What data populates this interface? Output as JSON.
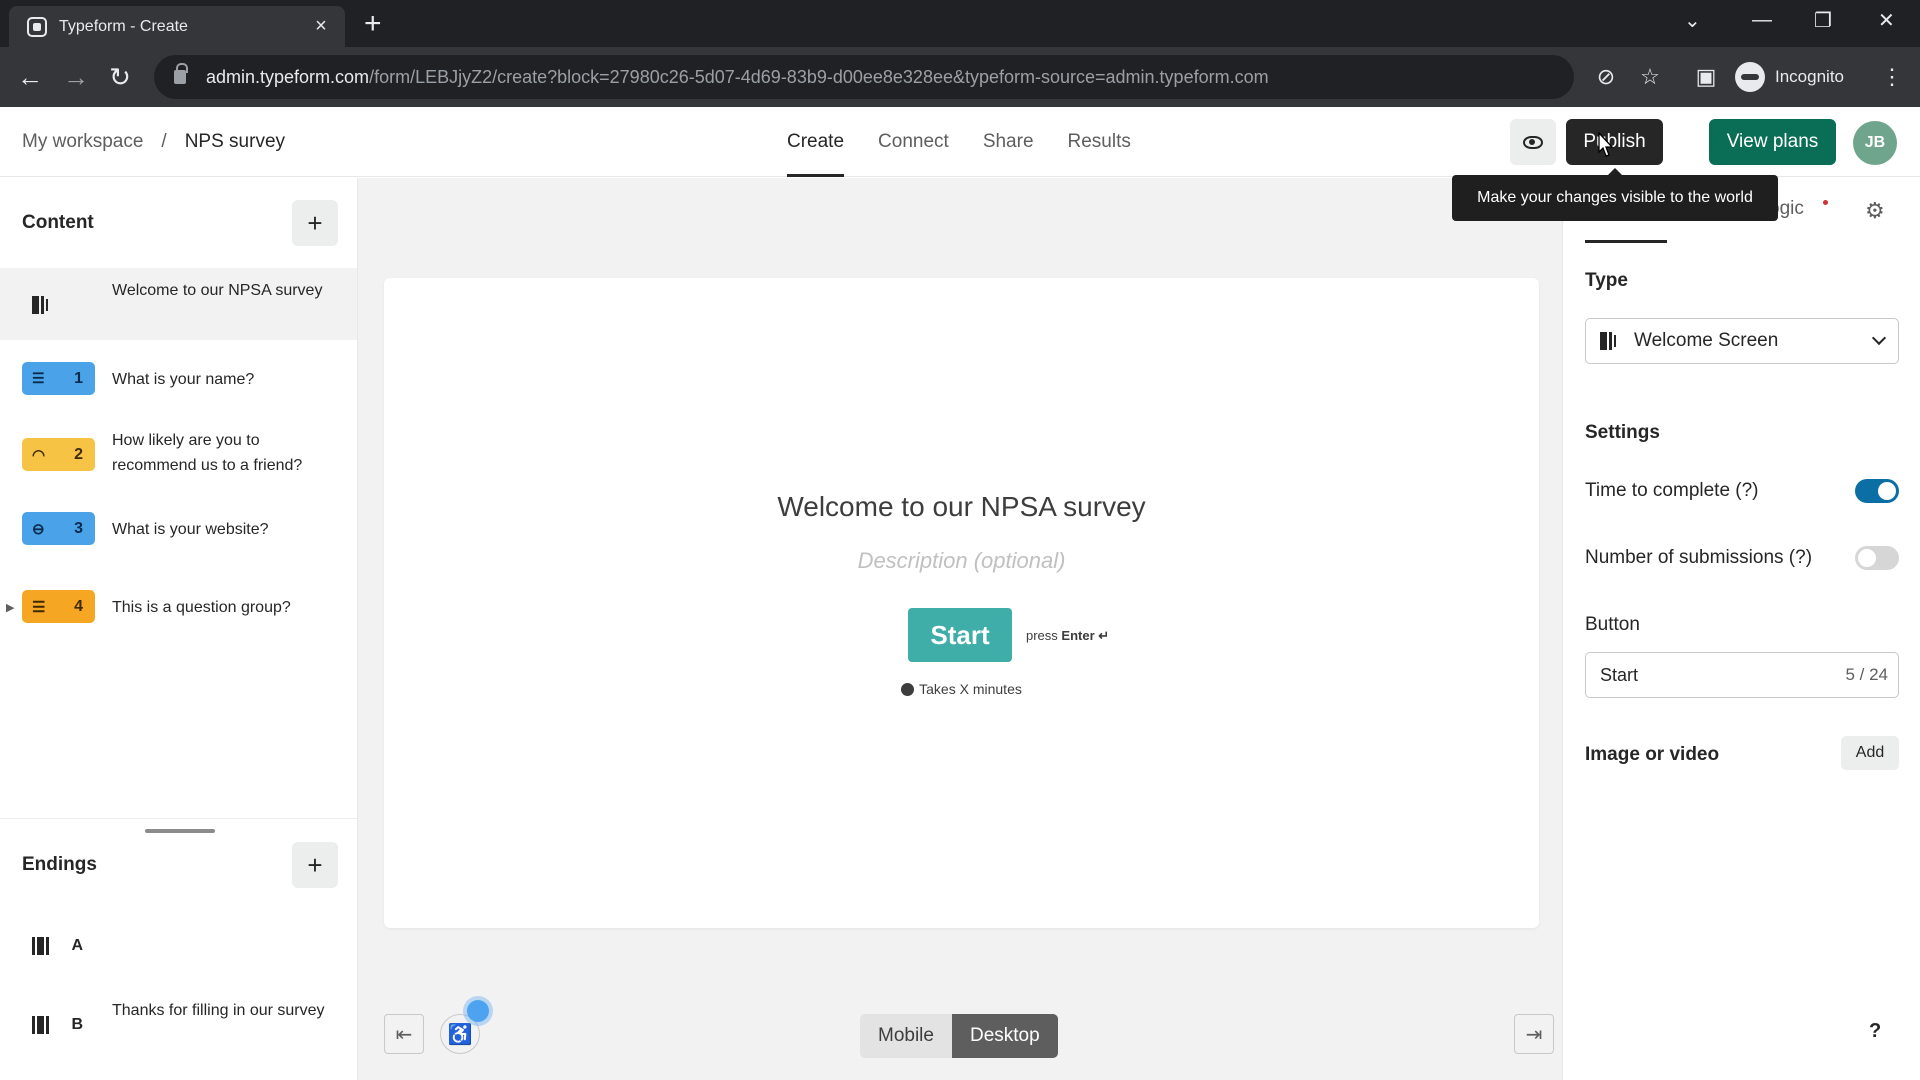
{
  "browser": {
    "tab_title": "Typeform - Create",
    "url_host": "admin.typeform.com",
    "url_path": "/form/LEBJjyZ2/create?block=27980c26-5d07-4d69-83b9-d00ee8e328ee&typeform-source=admin.typeform.com",
    "profile_label": "Incognito"
  },
  "header": {
    "breadcrumb_workspace": "My workspace",
    "breadcrumb_sep": "/",
    "breadcrumb_form": "NPS survey",
    "tabs": [
      "Create",
      "Connect",
      "Share",
      "Results"
    ],
    "publish_label": "Publish",
    "view_plans_label": "View plans",
    "avatar_initials": "JB",
    "tooltip": "Make your changes visible to the world"
  },
  "sidebar": {
    "content_title": "Content",
    "questions": [
      {
        "num": "",
        "text": "Welcome to our NPSA survey",
        "color": "#f2f2f2"
      },
      {
        "num": "1",
        "text": "What is your name?",
        "color": "#4aa3e8"
      },
      {
        "num": "2",
        "text": "How likely are you to recommend us to a friend?",
        "color": "#f6c344"
      },
      {
        "num": "3",
        "text": "What is your website?",
        "color": "#4aa3e8"
      },
      {
        "num": "4",
        "text": "This is a question group?",
        "color": "#f5a623"
      }
    ],
    "endings_title": "Endings",
    "endings": [
      {
        "letter": "A",
        "text": ""
      },
      {
        "letter": "B",
        "text": "Thanks for filling in our survey"
      }
    ]
  },
  "canvas": {
    "welcome_title": "Welcome to our NPSA survey",
    "description_placeholder": "Description (optional)",
    "start_label": "Start",
    "press_label": "press",
    "enter_label": "Enter ↵",
    "takes_label": "Takes X minutes",
    "mobile_label": "Mobile",
    "desktop_label": "Desktop"
  },
  "panel": {
    "logic_label": "ogic",
    "type_label": "Type",
    "type_value": "Welcome Screen",
    "settings_label": "Settings",
    "time_to_complete_label": "Time to complete (?)",
    "time_to_complete_on": true,
    "submissions_label": "Number of submissions (?)",
    "submissions_on": false,
    "button_label": "Button",
    "button_value": "Start",
    "button_count": "5 / 24",
    "media_label": "Image or video",
    "add_label": "Add",
    "help_label": "?"
  }
}
